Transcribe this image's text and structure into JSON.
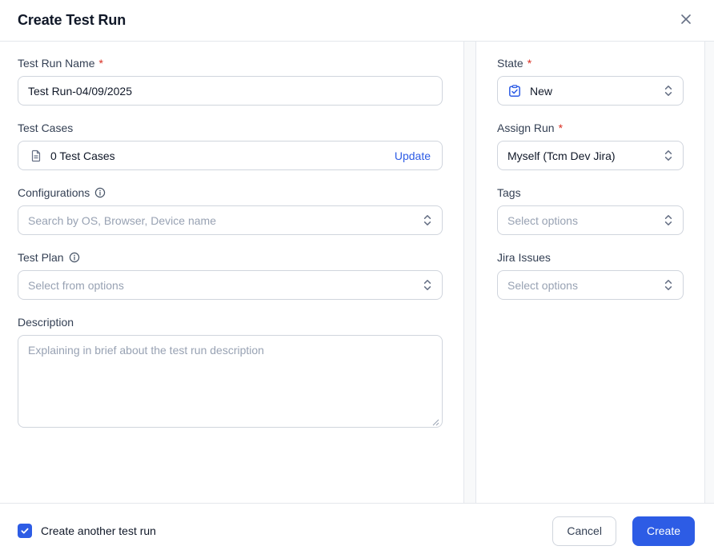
{
  "modal": {
    "title": "Create Test Run"
  },
  "required_marker": "*",
  "left": {
    "test_run_name": {
      "label": "Test Run Name",
      "value": "Test Run-04/09/2025"
    },
    "test_cases": {
      "label": "Test Cases",
      "summary": "0 Test Cases",
      "action_label": "Update"
    },
    "configurations": {
      "label": "Configurations",
      "placeholder": "Search by OS, Browser, Device name"
    },
    "test_plan": {
      "label": "Test Plan",
      "placeholder": "Select from options"
    },
    "description": {
      "label": "Description",
      "placeholder": "Explaining in brief about the test run description"
    }
  },
  "right": {
    "state": {
      "label": "State",
      "value": "New"
    },
    "assign_run": {
      "label": "Assign Run",
      "value": "Myself (Tcm Dev Jira)"
    },
    "tags": {
      "label": "Tags",
      "placeholder": "Select options"
    },
    "jira_issues": {
      "label": "Jira Issues",
      "placeholder": "Select options"
    }
  },
  "footer": {
    "create_another_label": "Create another test run",
    "create_another_checked": true,
    "cancel_label": "Cancel",
    "create_label": "Create"
  },
  "icons": {
    "close": "close-icon",
    "info": "info-icon",
    "document": "document-icon",
    "selector": "chevron-up-down-icon",
    "state_new": "clipboard-check-icon",
    "checkbox_check": "check-icon",
    "resize": "resize-handle-icon"
  },
  "colors": {
    "accent": "#2D5CE5",
    "link": "#2D5CE5",
    "required": "#D92D20",
    "border": "#D0D5DD",
    "divider": "#E4E7EC",
    "text": "#101828",
    "label": "#344054",
    "placeholder": "#98A2B3",
    "icon": "#667085"
  }
}
